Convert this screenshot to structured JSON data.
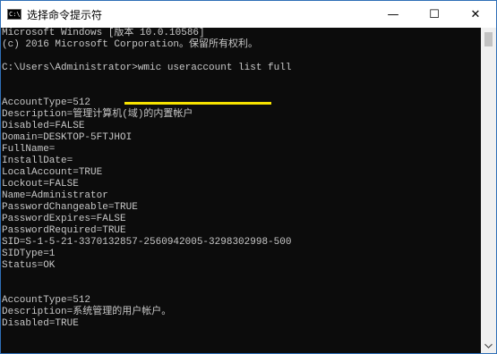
{
  "window": {
    "title": "选择命令提示符",
    "icon_glyph": "C:\\",
    "minimize_glyph": "—",
    "maximize_glyph": "☐",
    "close_glyph": "✕"
  },
  "console": {
    "lines": [
      "Microsoft Windows [版本 10.0.10586]",
      "(c) 2016 Microsoft Corporation。保留所有权利。",
      "",
      "C:\\Users\\Administrator>wmic useraccount list full",
      "",
      "",
      "AccountType=512",
      "Description=管理计算机(域)的内置帐户",
      "Disabled=FALSE",
      "Domain=DESKTOP-5FTJHOI",
      "FullName=",
      "InstallDate=",
      "LocalAccount=TRUE",
      "Lockout=FALSE",
      "Name=Administrator",
      "PasswordChangeable=TRUE",
      "PasswordExpires=FALSE",
      "PasswordRequired=TRUE",
      "SID=S-1-5-21-3370132857-2560942005-3298302998-500",
      "SIDType=1",
      "Status=OK",
      "",
      "",
      "AccountType=512",
      "Description=系统管理的用户帐户。",
      "Disabled=TRUE"
    ],
    "highlight_color": "#f7e200"
  },
  "colors": {
    "console_bg": "#0c0c0c",
    "console_text": "#c7c7c7",
    "window_border": "#2f6fb7"
  }
}
